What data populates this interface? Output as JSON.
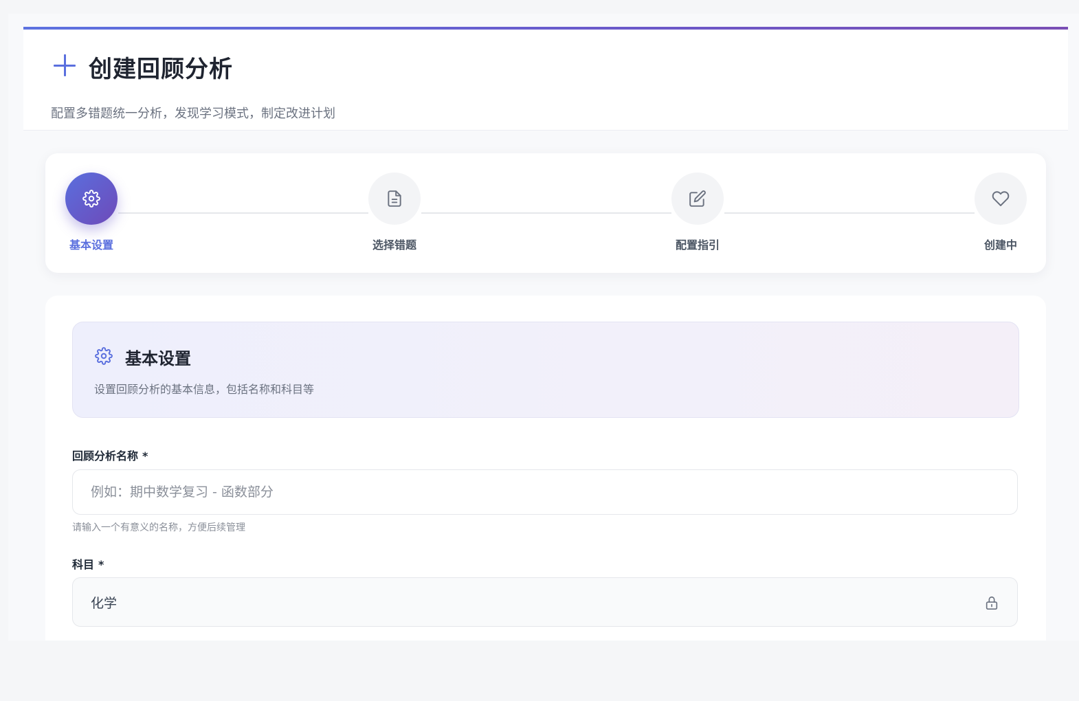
{
  "header": {
    "title": "创建回顾分析",
    "subtitle": "配置多错题统一分析，发现学习模式，制定改进计划"
  },
  "steps": [
    {
      "label": "基本设置",
      "icon": "gear-icon",
      "active": true
    },
    {
      "label": "选择错题",
      "icon": "document-icon",
      "active": false
    },
    {
      "label": "配置指引",
      "icon": "edit-icon",
      "active": false
    },
    {
      "label": "创建中",
      "icon": "heart-icon",
      "active": false
    }
  ],
  "section": {
    "title": "基本设置",
    "description": "设置回顾分析的基本信息，包括名称和科目等"
  },
  "form": {
    "name_label": "回顾分析名称",
    "required_mark": "*",
    "name_placeholder": "例如：期中数学复习 - 函数部分",
    "name_value": "",
    "name_hint": "请输入一个有意义的名称，方便后续管理",
    "subject_label": "科目",
    "subject_value": "化学"
  },
  "colors": {
    "accent": "#5a6fde",
    "accent_gradient_end": "#6e4ab9",
    "top_bar_end": "#7a4fb5"
  }
}
